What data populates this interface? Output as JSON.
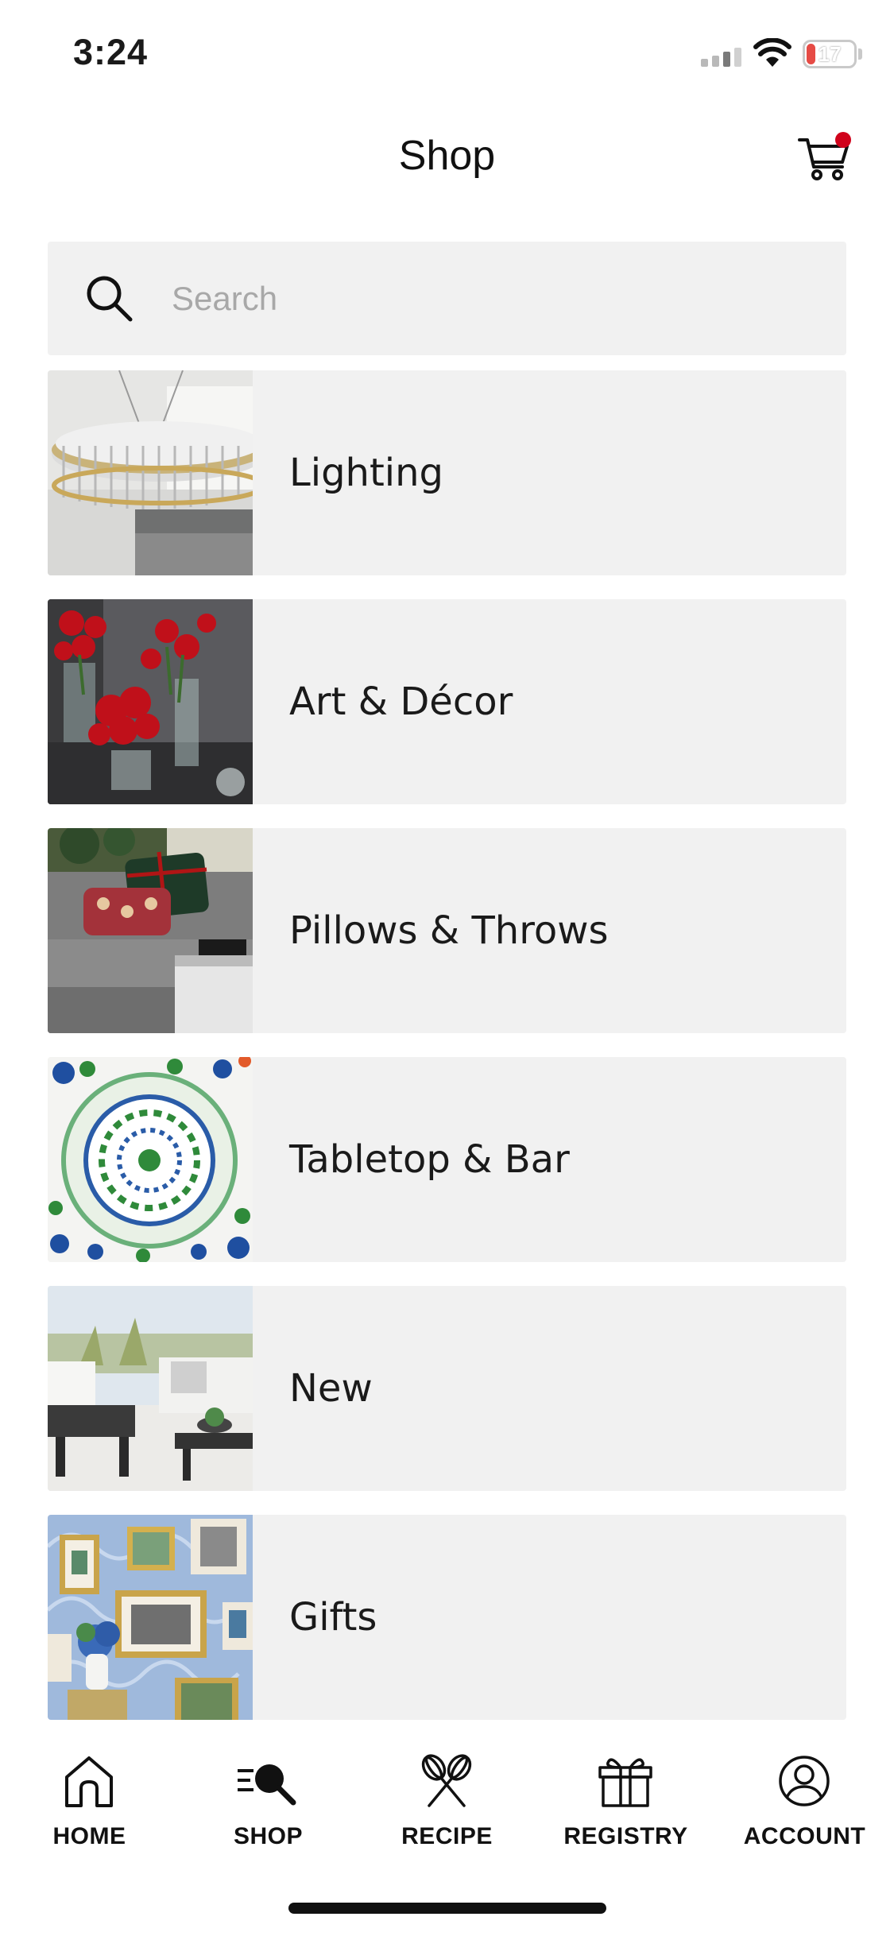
{
  "status_bar": {
    "time": "3:24",
    "battery_level": "17",
    "battery_fraction": 0.17
  },
  "header": {
    "title": "Shop",
    "cart_has_badge": true,
    "badge_color": "#d0021b"
  },
  "search": {
    "placeholder": "Search",
    "value": ""
  },
  "categories": [
    {
      "label": "Lighting",
      "thumb_icon": "chandelier-photo"
    },
    {
      "label": "Art & Décor",
      "thumb_icon": "red-flowers-photo"
    },
    {
      "label": "Pillows & Throws",
      "thumb_icon": "sofa-pillows-photo"
    },
    {
      "label": "Tabletop & Bar",
      "thumb_icon": "blue-green-plate-photo"
    },
    {
      "label": "New",
      "thumb_icon": "outdoor-furniture-photo"
    },
    {
      "label": "Gifts",
      "thumb_icon": "picture-frames-photo"
    }
  ],
  "tabbar": {
    "tabs": [
      {
        "label": "HOME",
        "icon": "home-icon"
      },
      {
        "label": "SHOP",
        "icon": "shop-search-icon"
      },
      {
        "label": "RECIPE",
        "icon": "whisk-icon"
      },
      {
        "label": "REGISTRY",
        "icon": "gift-icon"
      },
      {
        "label": "ACCOUNT",
        "icon": "account-icon"
      }
    ]
  },
  "colors": {
    "tile_background": "#f1f1f1",
    "accent": "#d0021b",
    "text": "#1a1a1a"
  }
}
